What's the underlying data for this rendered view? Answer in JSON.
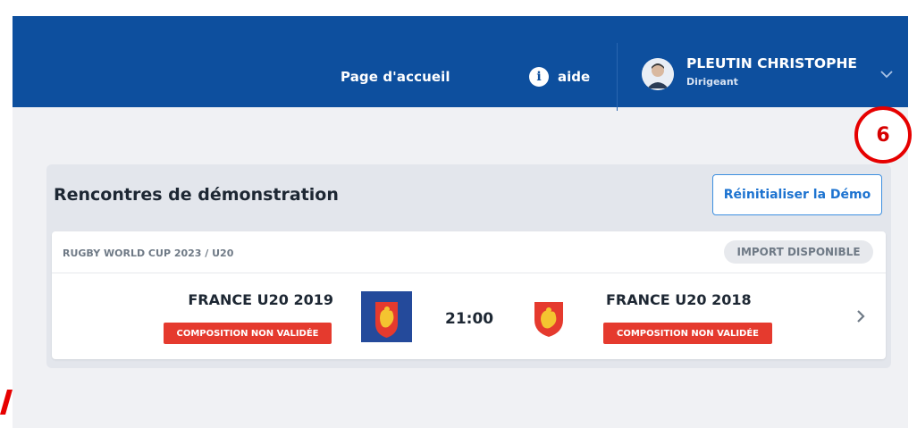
{
  "header": {
    "nav_home": "Page d'accueil",
    "help_label": "aide",
    "help_icon": "i",
    "user_name": "PLEUTIN CHRISTOPHE",
    "user_role": "Dirigeant"
  },
  "marker_number": "6",
  "panel": {
    "title": "Rencontres de démonstration",
    "reset_button": "Réinitialiser la Démo"
  },
  "match": {
    "competition": "RUGBY WORLD CUP 2023 / U20",
    "import_badge": "IMPORT DISPONIBLE",
    "home_team": "FRANCE U20 2019",
    "away_team": "FRANCE U20 2018",
    "time": "21:00",
    "home_status": "COMPOSITION NON VALIDÉE",
    "away_status": "COMPOSITION NON VALIDÉE"
  },
  "colors": {
    "header_bg": "#0d4f9e",
    "status_red": "#e53a2e",
    "accent_blue": "#1d73d0",
    "marker_red": "#e60000"
  },
  "icons": [
    "info-icon",
    "avatar-icon",
    "chevron-down-icon",
    "chevron-right-icon",
    "rooster-logo-icon"
  ]
}
